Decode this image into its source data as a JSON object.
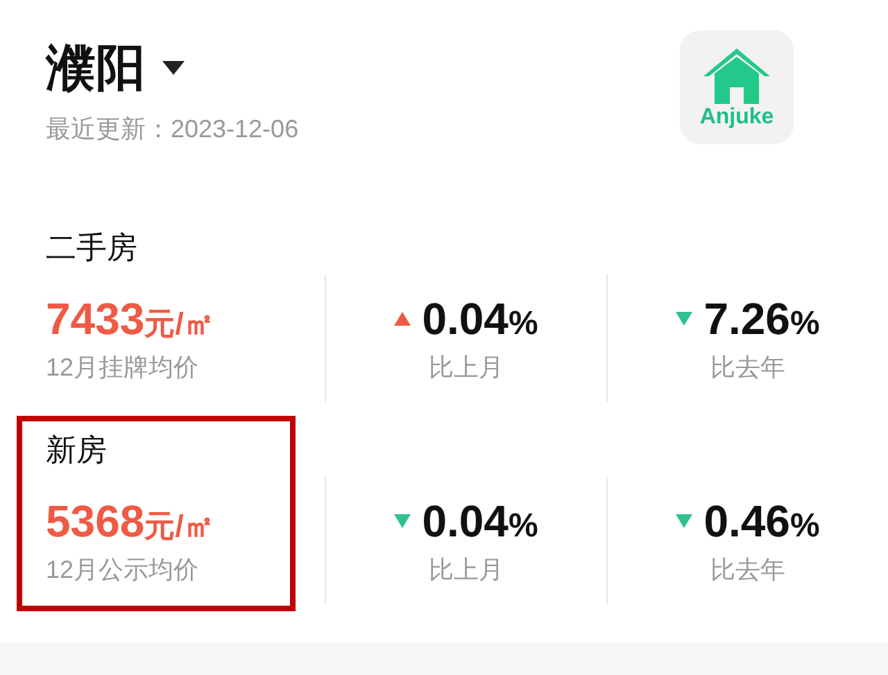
{
  "city": "濮阳",
  "updated": "最近更新：2023-12-06",
  "logo": {
    "text": "Anjuke"
  },
  "sections": [
    {
      "label": "二手房",
      "price": "7433",
      "unit": "元/㎡",
      "caption": "12月挂牌均价",
      "highlighted": false,
      "stats": [
        {
          "kind": "up",
          "value": "0.04",
          "percent": "%",
          "caption": "比上月"
        },
        {
          "kind": "down",
          "value": "7.26",
          "percent": "%",
          "caption": "比去年"
        }
      ]
    },
    {
      "label": "新房",
      "price": "5368",
      "unit": "元/㎡",
      "caption": "12月公示均价",
      "highlighted": true,
      "stats": [
        {
          "kind": "down",
          "value": "0.04",
          "percent": "%",
          "caption": "比上月"
        },
        {
          "kind": "down",
          "value": "0.46",
          "percent": "%",
          "caption": "比去年"
        }
      ]
    }
  ]
}
